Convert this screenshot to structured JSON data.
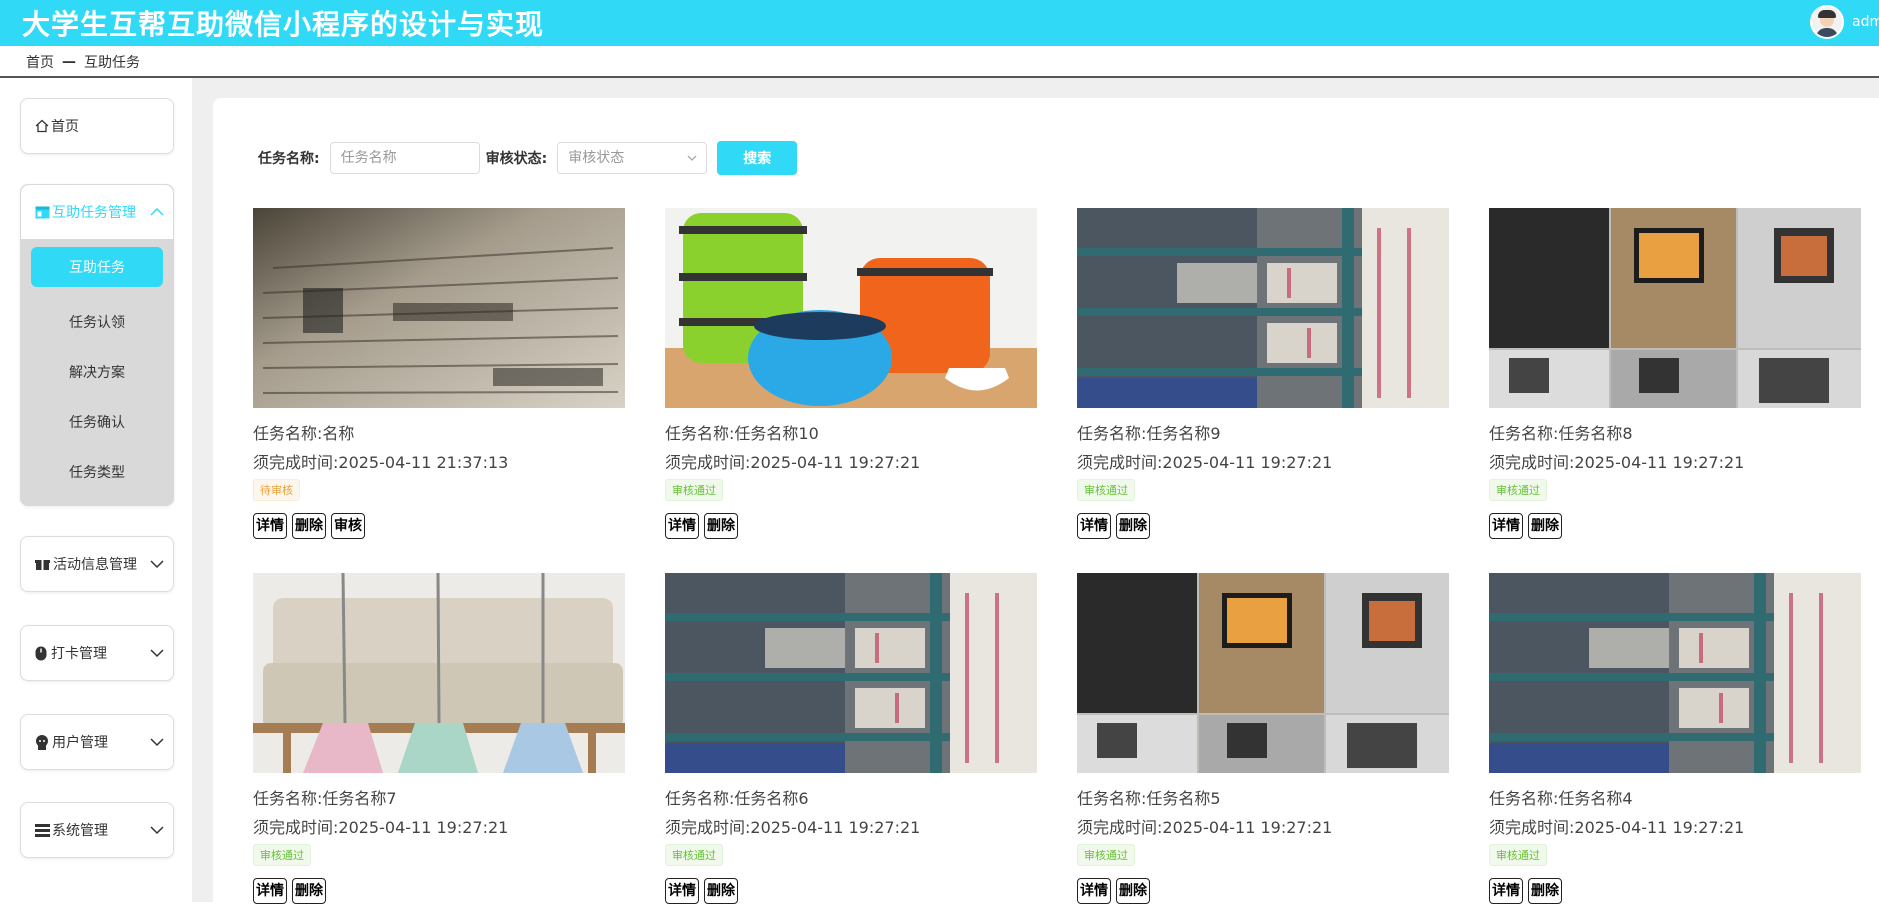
{
  "header": {
    "title": "大学生互帮互助微信小程序的设计与实现",
    "username": "admi"
  },
  "breadcrumb": {
    "home": "首页",
    "separator": "—",
    "current": "互助任务"
  },
  "sidebar": {
    "home": "首页",
    "groups": [
      {
        "label": "互助任务管理",
        "expanded": true,
        "items": [
          "互助任务",
          "任务认领",
          "解决方案",
          "任务确认",
          "任务类型"
        ],
        "active_item": "互助任务"
      },
      {
        "label": "活动信息管理",
        "expanded": false
      },
      {
        "label": "打卡管理",
        "expanded": false
      },
      {
        "label": "用户管理",
        "expanded": false
      },
      {
        "label": "系统管理",
        "expanded": false
      }
    ]
  },
  "search": {
    "name_label": "任务名称:",
    "name_placeholder": "任务名称",
    "status_label": "审核状态:",
    "status_placeholder": "审核状态",
    "button": "搜索"
  },
  "labels": {
    "name_prefix": "任务名称:",
    "time_prefix": "须完成时间:"
  },
  "actions": {
    "detail": "详情",
    "delete": "删除",
    "review": "审核"
  },
  "colors": {
    "accent": "#30d9f6",
    "pending": "#e6a23c",
    "passed": "#67c23a"
  },
  "cards": [
    {
      "name": "名称",
      "time": "2025-04-11 21:37:13",
      "status": "待审核",
      "status_type": "pending",
      "image": "newspaper-image",
      "show_review": true
    },
    {
      "name": "任务名称10",
      "time": "2025-04-11 19:27:21",
      "status": "审核通过",
      "status_type": "passed",
      "image": "lunchbox-image",
      "show_review": false
    },
    {
      "name": "任务名称9",
      "time": "2025-04-11 19:27:21",
      "status": "审核通过",
      "status_type": "passed",
      "image": "shelves-image",
      "show_review": false
    },
    {
      "name": "任务名称8",
      "time": "2025-04-11 19:27:21",
      "status": "审核通过",
      "status_type": "passed",
      "image": "tv-collage-image",
      "show_review": false
    },
    {
      "name": "任务名称7",
      "time": "2025-04-11 19:27:21",
      "status": "审核通过",
      "status_type": "passed",
      "image": "sofa-brooms-image",
      "show_review": false
    },
    {
      "name": "任务名称6",
      "time": "2025-04-11 19:27:21",
      "status": "审核通过",
      "status_type": "passed",
      "image": "shelves-image",
      "show_review": false
    },
    {
      "name": "任务名称5",
      "time": "2025-04-11 19:27:21",
      "status": "审核通过",
      "status_type": "passed",
      "image": "tv-collage-image",
      "show_review": false
    },
    {
      "name": "任务名称4",
      "time": "2025-04-11 19:27:21",
      "status": "审核通过",
      "status_type": "passed",
      "image": "shelves-image",
      "show_review": false
    }
  ]
}
